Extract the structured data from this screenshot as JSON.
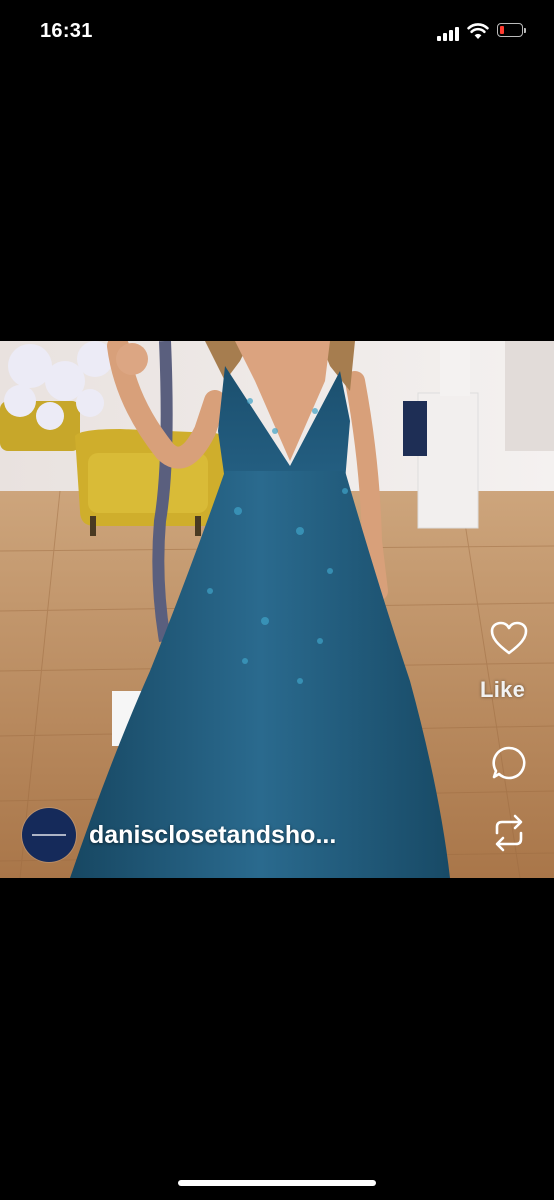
{
  "status_bar": {
    "time": "16:31",
    "icons": [
      "cellular-signal-icon",
      "wifi-icon",
      "low-battery-icon"
    ],
    "battery_color": "#ff3b30"
  },
  "post": {
    "image_description_icon": "photo",
    "username": "danisclosetandsho...",
    "avatar_icon": "account-logo-avatar",
    "actions": {
      "like_icon": "heart-icon",
      "like_label": "Like",
      "comment_icon": "comment-icon",
      "repost_icon": "repost-icon"
    }
  },
  "colors": {
    "background": "#000000",
    "dress": "#1f5f7e",
    "floor": "#b8895c",
    "avatar": "#152a5a"
  }
}
